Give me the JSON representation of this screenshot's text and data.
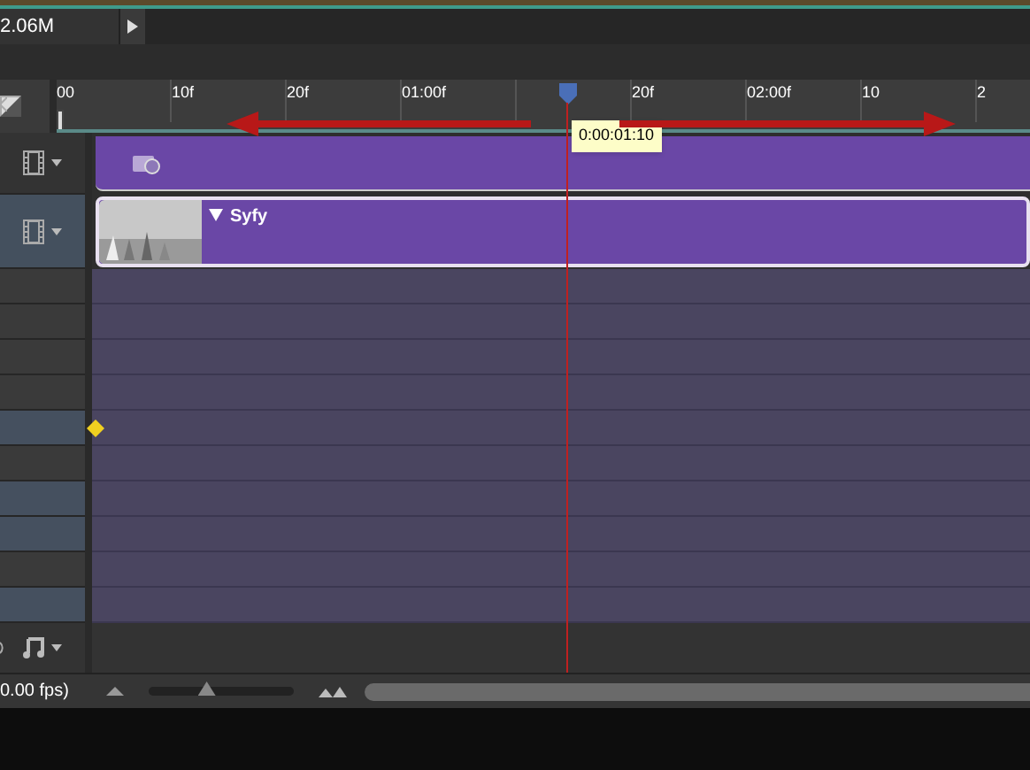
{
  "top_bar": {
    "size": "2.06M"
  },
  "ruler": {
    "marks": [
      {
        "kind": "label",
        "text": "00"
      },
      {
        "kind": "label",
        "text": "10f"
      },
      {
        "kind": "label",
        "text": "20f"
      },
      {
        "kind": "label",
        "text": "01:00f"
      },
      {
        "kind": "tick"
      },
      {
        "kind": "label",
        "text": "20f"
      },
      {
        "kind": "label",
        "text": "02:00f"
      },
      {
        "kind": "label",
        "text": "10"
      },
      {
        "kind": "label",
        "text": "2"
      }
    ]
  },
  "playhead": {
    "time": "0:00:01:10"
  },
  "tracks": [
    {
      "kind": "adjustment"
    },
    {
      "kind": "video",
      "label": "Syfy"
    }
  ],
  "rows": [
    {
      "selected": false,
      "keyframe": false
    },
    {
      "selected": false,
      "keyframe": false
    },
    {
      "selected": false,
      "keyframe": false
    },
    {
      "selected": false,
      "keyframe": false
    },
    {
      "selected": true,
      "keyframe": true
    },
    {
      "selected": false,
      "keyframe": false
    },
    {
      "selected": true,
      "keyframe": false
    },
    {
      "selected": true,
      "keyframe": false
    },
    {
      "selected": false,
      "keyframe": false
    },
    {
      "selected": true,
      "keyframe": false
    }
  ],
  "status": {
    "fps": "0.00 fps)",
    "zoom": {
      "level": 0.4
    }
  }
}
